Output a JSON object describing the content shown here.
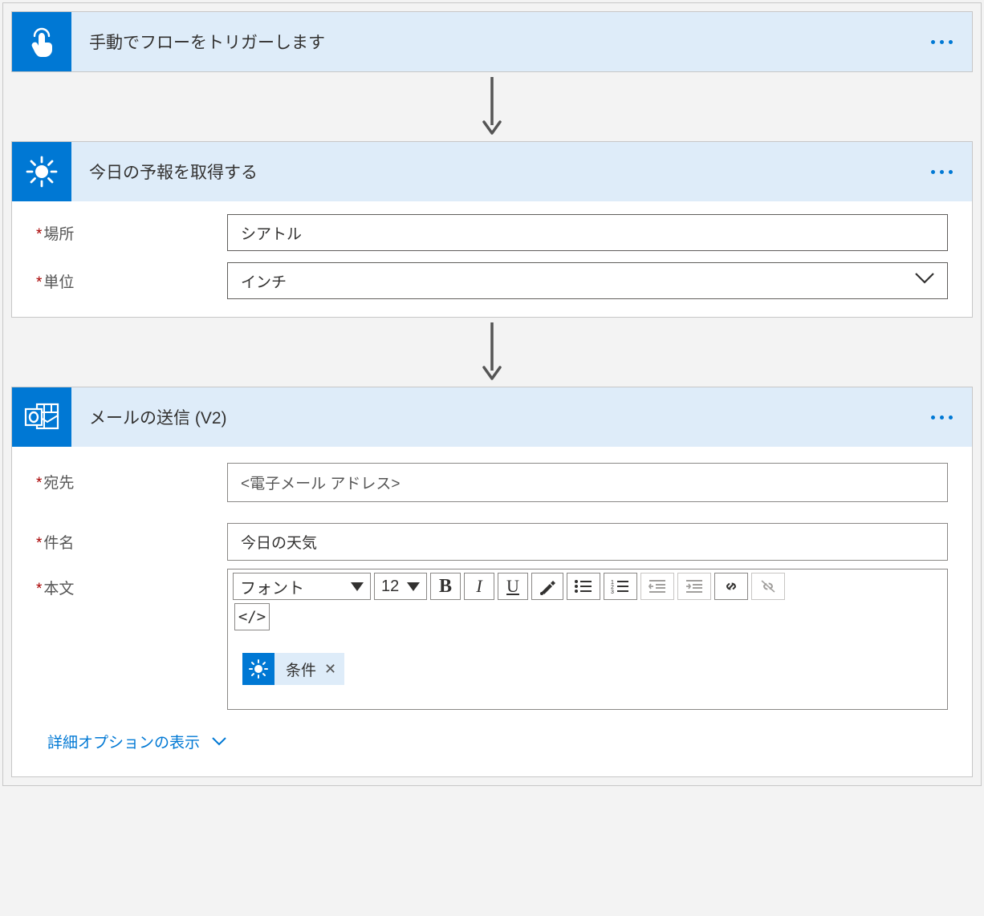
{
  "trigger": {
    "title": "手動でフローをトリガーします"
  },
  "forecast": {
    "title": "今日の予報を取得する",
    "location_label": "場所",
    "location_value": "シアトル",
    "unit_label": "単位",
    "unit_value": "インチ"
  },
  "email": {
    "title": "メールの送信 (V2)",
    "to_label": "宛先",
    "to_value": "<電子メール アドレス>",
    "subject_label": "件名",
    "subject_value": "今日の天気",
    "body_label": "本文",
    "rte": {
      "font_label": "フォント",
      "size_label": "12",
      "code_label": "</>"
    },
    "token_label": "条件",
    "advanced_label": "詳細オプションの表示"
  }
}
